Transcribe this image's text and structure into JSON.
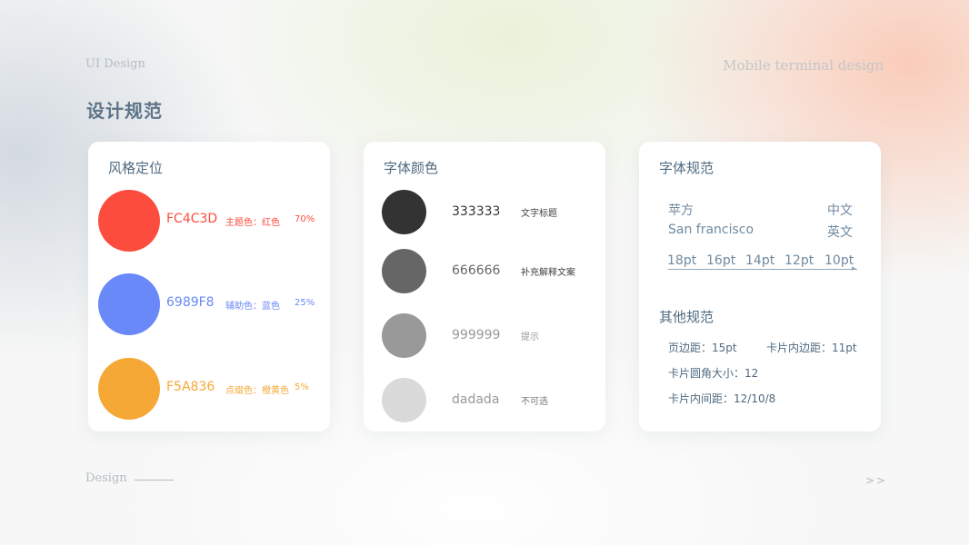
{
  "header": {
    "left_label": "UI Design",
    "right_label": "Mobile terminal design",
    "page_title": "设计规范"
  },
  "style_card": {
    "title": "风格定位",
    "swatches": [
      {
        "hex": "FC4C3D",
        "role": "主题色：红色",
        "percent": "70%",
        "color": "#FC4C3D"
      },
      {
        "hex": "6989F8",
        "role": "辅助色：蓝色",
        "percent": "25%",
        "color": "#6989F8"
      },
      {
        "hex": "F5A836",
        "role": "点缀色：橙黄色",
        "percent": "5%",
        "color": "#F5A836"
      }
    ]
  },
  "font_color_card": {
    "title": "字体颜色",
    "items": [
      {
        "hex": "333333",
        "usage": "文字标题",
        "color": "#333333"
      },
      {
        "hex": "666666",
        "usage": "补充解释文案",
        "color": "#666666"
      },
      {
        "hex": "999999",
        "usage": "提示",
        "color": "#999999"
      },
      {
        "hex": "dadada",
        "usage": "不可选",
        "color": "#dadada"
      }
    ]
  },
  "typography_card": {
    "title": "字体规范",
    "fonts": [
      {
        "name": "苹方",
        "label": "中文"
      },
      {
        "name": "San francisco",
        "label": "英文"
      }
    ],
    "sizes": [
      "18pt",
      "16pt",
      "14pt",
      "12pt",
      "10pt"
    ],
    "other_title": "其他规范",
    "specs": {
      "page_margin": "页边距：15pt",
      "card_padding": "卡片内边距：11pt",
      "card_radius": "卡片圆角大小：12",
      "card_spacing": "卡片内间距：12/10/8"
    }
  },
  "footer": {
    "label": "Design",
    "next": ">>"
  }
}
